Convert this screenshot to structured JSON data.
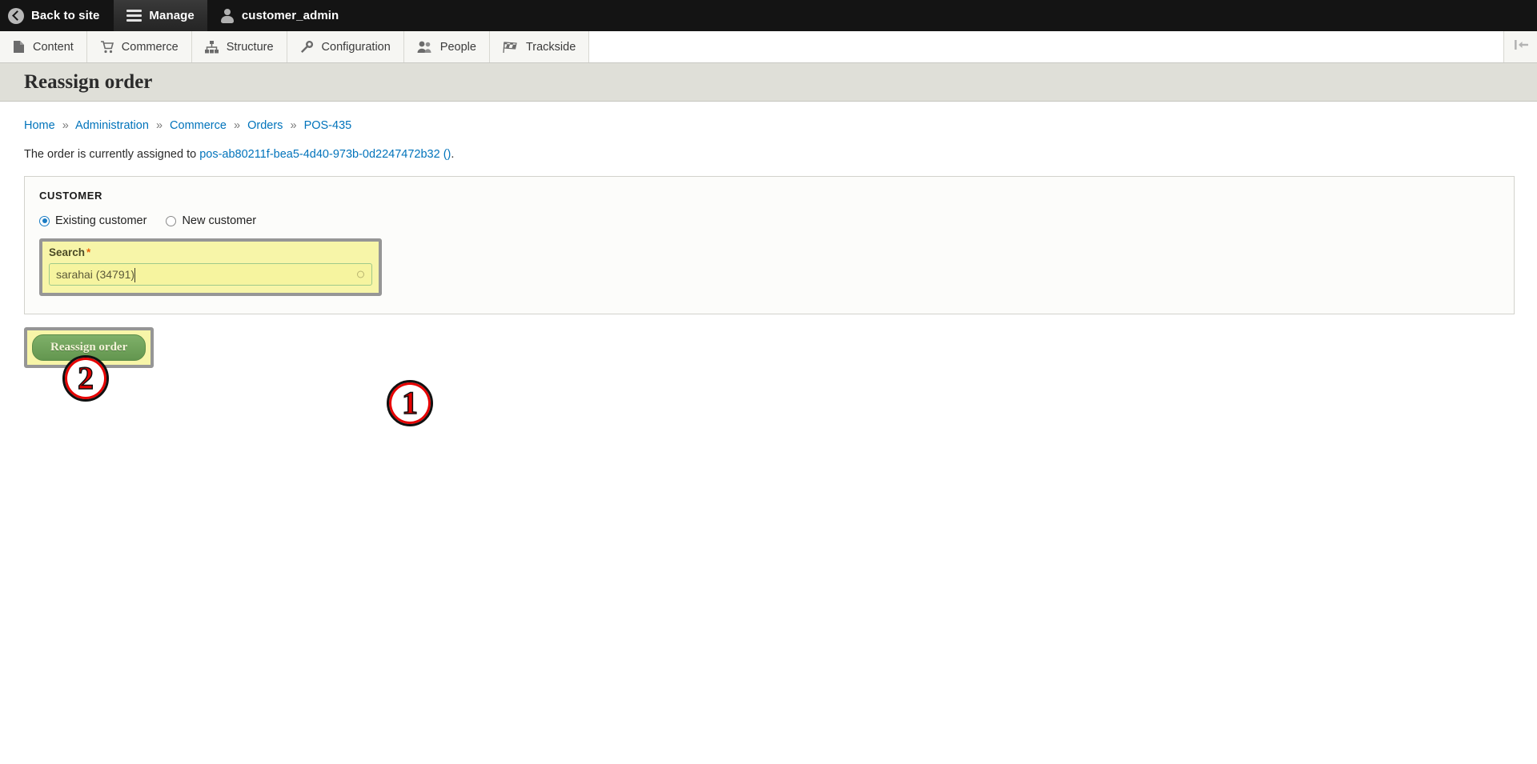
{
  "toolbar": {
    "back_to_site": "Back to site",
    "manage": "Manage",
    "user": "customer_admin"
  },
  "menu": {
    "items": [
      {
        "label": "Content",
        "icon": "document-icon"
      },
      {
        "label": "Commerce",
        "icon": "cart-icon"
      },
      {
        "label": "Structure",
        "icon": "sitemap-icon"
      },
      {
        "label": "Configuration",
        "icon": "wrench-icon"
      },
      {
        "label": "People",
        "icon": "people-icon"
      },
      {
        "label": "Trackside",
        "icon": "checkered-flag-icon"
      }
    ],
    "orientation_toggle_icon": "collapse-sidebar-icon"
  },
  "page": {
    "title": "Reassign order"
  },
  "breadcrumb": {
    "separator": "»",
    "items": [
      "Home",
      "Administration",
      "Commerce",
      "Orders",
      "POS-435"
    ]
  },
  "assigned": {
    "prefix": "The order is currently assigned to ",
    "link": "pos-ab80211f-bea5-4d40-973b-0d2247472b32 ()",
    "suffix": "."
  },
  "customer": {
    "legend": "CUSTOMER",
    "options": [
      {
        "label": "Existing customer",
        "selected": true
      },
      {
        "label": "New customer",
        "selected": false
      }
    ],
    "search": {
      "label": "Search",
      "required_marker": "*",
      "value": "sarahai (34791)",
      "placeholder": ""
    }
  },
  "actions": {
    "submit_label": "Reassign order"
  },
  "annotations": [
    {
      "number": "1"
    },
    {
      "number": "2"
    }
  ],
  "colors": {
    "toolbar_bg": "#141414",
    "title_band": "#dfdfd8",
    "link": "#0073bb",
    "highlight": "#f7f5a8",
    "button_green": "#63964f",
    "marker_red": "#e60000"
  }
}
